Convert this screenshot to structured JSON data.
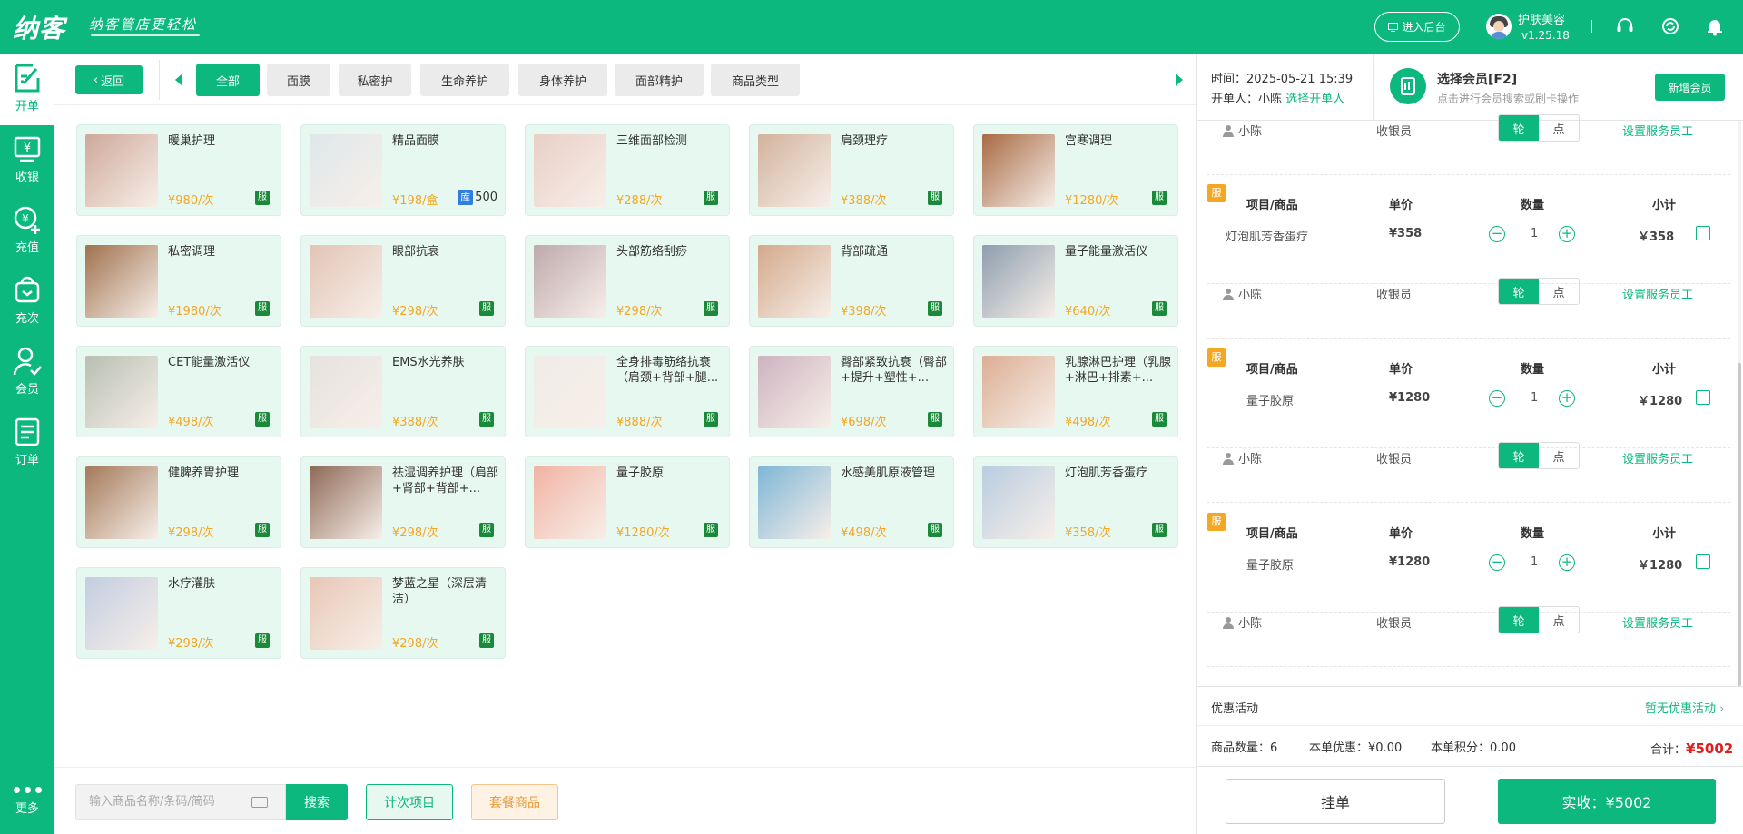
{
  "brand": {
    "logo": "纳客",
    "slogan": "纳客管店更轻松"
  },
  "header": {
    "backend_button": "进入后台",
    "user_name": "护肤美容",
    "version": "v1.25.18"
  },
  "nav": [
    {
      "label": "开单",
      "icon": "billing-icon"
    },
    {
      "label": "收银",
      "icon": "cashier-icon"
    },
    {
      "label": "充值",
      "icon": "recharge-icon"
    },
    {
      "label": "充次",
      "icon": "recharge-times-icon"
    },
    {
      "label": "会员",
      "icon": "member-icon"
    },
    {
      "label": "订单",
      "icon": "orders-icon"
    }
  ],
  "nav_more": "更多",
  "back_button": "返回",
  "tabs": [
    "全部",
    "面膜",
    "私密护",
    "生命养护",
    "身体养护",
    "面部精护",
    "商品类型"
  ],
  "products": [
    {
      "name": "暖巢护理",
      "price": "¥980/次",
      "badge": "服",
      "thumb_color": "#cfa89a"
    },
    {
      "name": "精品面膜",
      "price": "¥198/盒",
      "stock_label": "库",
      "stock": "500",
      "thumb_color": "#dfe8ea"
    },
    {
      "name": "三维面部检测",
      "price": "¥288/次",
      "badge": "服",
      "thumb_color": "#e9cfc6"
    },
    {
      "name": "肩颈理疗",
      "price": "¥388/次",
      "badge": "服",
      "thumb_color": "#d2b39d"
    },
    {
      "name": "宫寒调理",
      "price": "¥1280/次",
      "badge": "服",
      "thumb_color": "#a86a44"
    },
    {
      "name": "私密调理",
      "price": "¥1980/次",
      "badge": "服",
      "thumb_color": "#a0724f"
    },
    {
      "name": "眼部抗衰",
      "price": "¥298/次",
      "badge": "服",
      "thumb_color": "#e3c4b6"
    },
    {
      "name": "头部筋络刮痧",
      "price": "¥298/次",
      "badge": "服",
      "thumb_color": "#bfa9ad"
    },
    {
      "name": "背部疏通",
      "price": "¥398/次",
      "badge": "服",
      "thumb_color": "#d3a98b"
    },
    {
      "name": "量子能量激活仪",
      "price": "¥640/次",
      "badge": "服",
      "thumb_color": "#8e9eae"
    },
    {
      "name": "CET能量激活仪",
      "price": "¥498/次",
      "badge": "服",
      "thumb_color": "#b7bfb2"
    },
    {
      "name": "EMS水光养肤",
      "price": "¥388/次",
      "badge": "服",
      "thumb_color": "#e6e2df"
    },
    {
      "name": "全身排毒筋络抗衰（肩颈+背部+腿...",
      "price": "¥888/次",
      "badge": "服",
      "thumb_color": "#f0ece7"
    },
    {
      "name": "臀部紧致抗衰（臀部+提升+塑性+...",
      "price": "¥698/次",
      "badge": "服",
      "thumb_color": "#cdb3c0"
    },
    {
      "name": "乳腺淋巴护理（乳腺+淋巴+排素+...",
      "price": "¥498/次",
      "badge": "服",
      "thumb_color": "#dcae93"
    },
    {
      "name": "健脾养胃护理",
      "price": "¥298/次",
      "badge": "服",
      "thumb_color": "#a47a5a"
    },
    {
      "name": "祛湿调养护理（肩部+肾部+背部+...",
      "price": "¥298/次",
      "badge": "服",
      "thumb_color": "#8f6a58"
    },
    {
      "name": "量子胶原",
      "price": "¥1280/次",
      "badge": "服",
      "thumb_color": "#f2b3a3"
    },
    {
      "name": "水感美肌原液管理",
      "price": "¥498/次",
      "badge": "服",
      "thumb_color": "#7fb6d6"
    },
    {
      "name": "灯泡肌芳香蛋疗",
      "price": "¥358/次",
      "badge": "服",
      "thumb_color": "#b9cde0"
    },
    {
      "name": "水疗灌肤",
      "price": "¥298/次",
      "badge": "服",
      "thumb_color": "#c3cde0"
    },
    {
      "name": "梦蓝之星（深层清洁）",
      "price": "¥298/次",
      "badge": "服",
      "thumb_color": "#e8c7b6"
    }
  ],
  "search": {
    "placeholder": "输入商品名称/条码/简码",
    "button": "搜索"
  },
  "filters": {
    "count_items": "计次项目",
    "package_items": "套餐商品"
  },
  "order": {
    "time_label": "时间：",
    "time_value": "2025-05-21 15:39",
    "opener_label": "开单人：",
    "opener_name": "小陈",
    "opener_link": "选择开单人"
  },
  "member": {
    "title": "选择会员[F2]",
    "subtitle": "点击进行会员搜索或刷卡操作",
    "new_button": "新增会员"
  },
  "cart": {
    "headers": {
      "item": "项目/商品",
      "unit_price": "单价",
      "qty": "数量",
      "subtotal": "小计"
    },
    "staff": {
      "name": "小陈",
      "role": "收银员",
      "mode_round": "轮",
      "mode_point": "点",
      "set_link": "设置服务员工"
    },
    "items": [
      {
        "badge": "服",
        "name": "灯泡肌芳香蛋疗",
        "price": "¥358",
        "qty": "1",
        "subtotal": "￥358"
      },
      {
        "badge": "服",
        "name": "量子胶原",
        "price": "¥1280",
        "qty": "1",
        "subtotal": "￥1280"
      },
      {
        "badge": "服",
        "name": "量子胶原",
        "price": "¥1280",
        "qty": "1",
        "subtotal": "￥1280"
      }
    ]
  },
  "promo": {
    "label": "优惠活动",
    "value": "暂无优惠活动"
  },
  "summary": {
    "count_label": "商品数量：",
    "count": "6",
    "discount_label": "本单优惠：",
    "discount": "¥0.00",
    "points_label": "本单积分：",
    "points": "0.00",
    "total_label": "合计：",
    "total": "¥5002"
  },
  "actions": {
    "hold": "挂单",
    "pay": "实收：¥5002"
  },
  "colors": {
    "brand": "#0cb87e",
    "price": "#f5a623",
    "total": "#e02020",
    "service_badge": "#1a8a3a"
  }
}
